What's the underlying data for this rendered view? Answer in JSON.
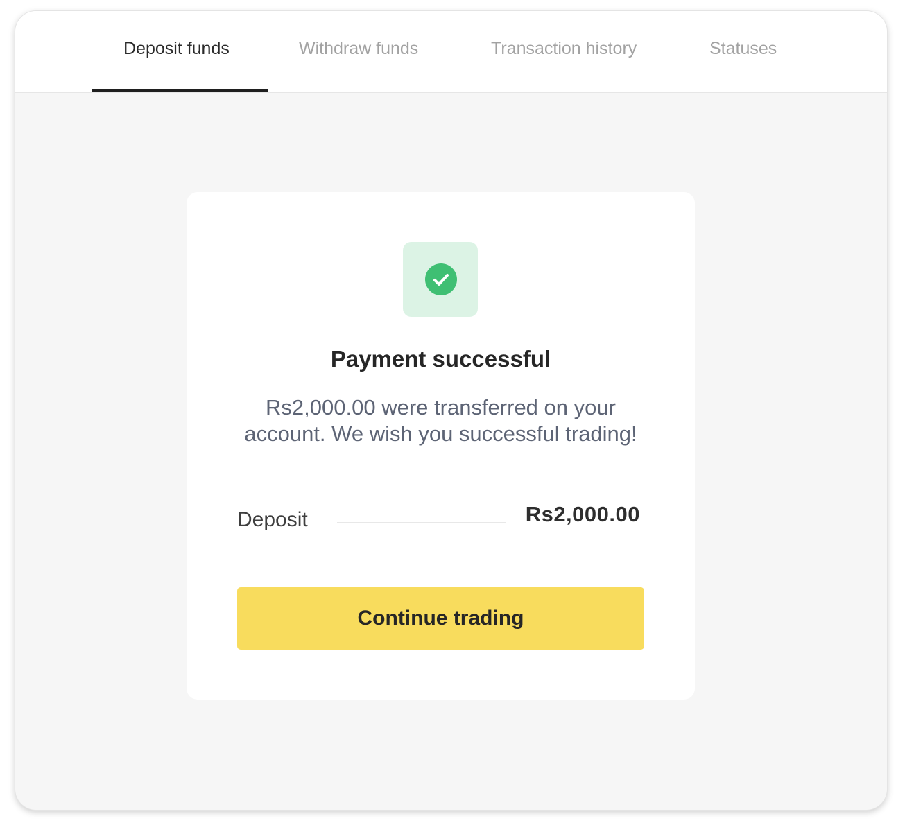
{
  "tabs": [
    {
      "label": "Deposit funds",
      "active": true
    },
    {
      "label": "Withdraw funds",
      "active": false
    },
    {
      "label": "Transaction history",
      "active": false
    },
    {
      "label": "Statuses",
      "active": false
    }
  ],
  "card": {
    "icon": "check-circle-icon",
    "title": "Payment successful",
    "message": "Rs2,000.00 were transferred on your account. We wish you successful trading!",
    "deposit_label": "Deposit",
    "deposit_value": "Rs2,000.00",
    "button_label": "Continue trading"
  },
  "colors": {
    "accent_button": "#f8dc5d",
    "success_green": "#3fbf73",
    "success_bg": "#dcf3e5"
  }
}
